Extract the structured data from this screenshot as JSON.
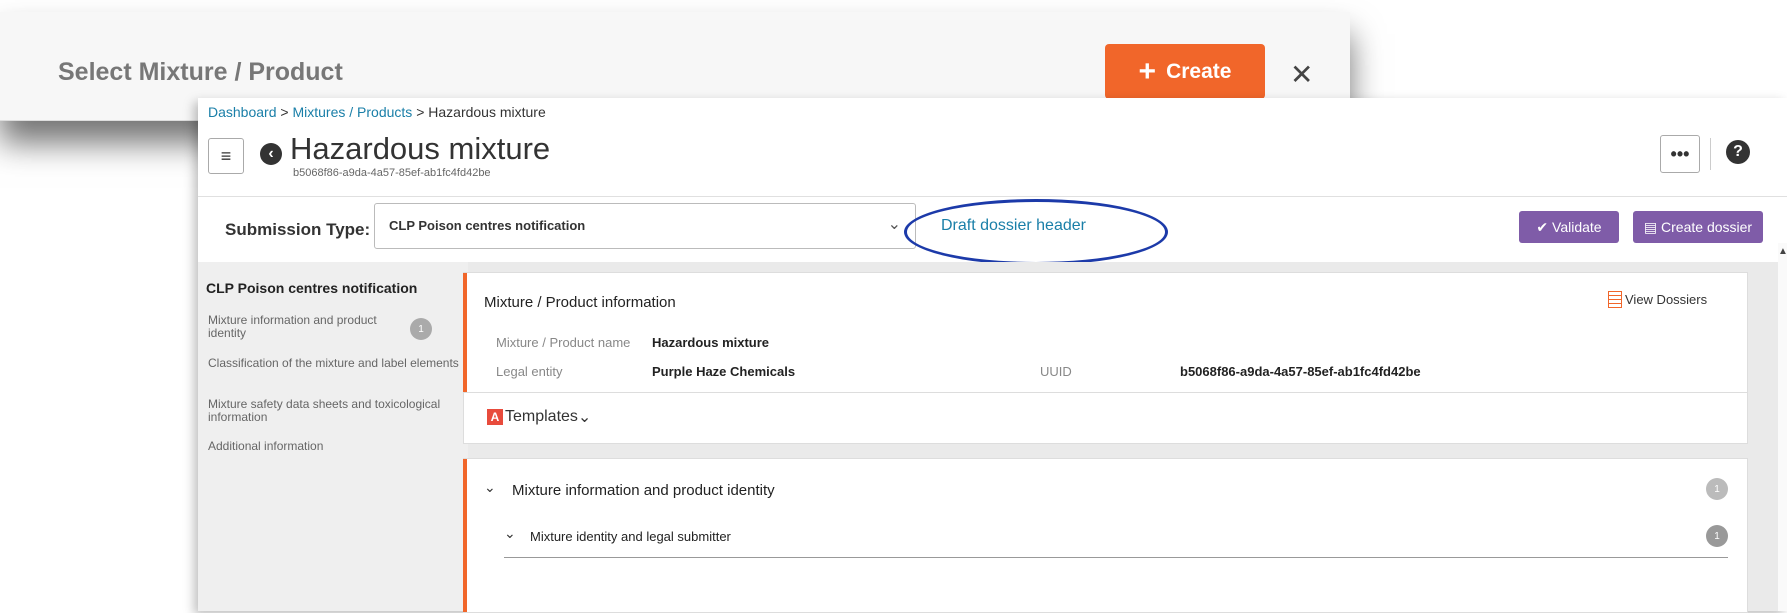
{
  "bg_dialog": {
    "title": "Select Mixture / Product",
    "create_label": "Create",
    "close_label": "✕"
  },
  "breadcrumb": {
    "items": [
      "Dashboard",
      "Mixtures / Products",
      "Hazardous mixture"
    ],
    "separator": ">"
  },
  "header": {
    "title": "Hazardous mixture",
    "uuid": "b5068f86-a9da-4a57-85ef-ab1fc4fd42be",
    "more_label": "•••",
    "help_label": "?"
  },
  "submission": {
    "label": "Submission Type:",
    "selected": "CLP Poison centres notification",
    "draft_link": "Draft dossier header",
    "validate_label": "Validate",
    "create_dossier_label": "Create dossier"
  },
  "sidebar": {
    "heading": "CLP Poison centres notification",
    "items": [
      {
        "label": "Mixture information and product identity",
        "badge": "1"
      },
      {
        "label": "Classification of the mixture and label elements"
      },
      {
        "label": "Mixture safety data sheets and toxicological information"
      },
      {
        "label": "Additional information"
      }
    ]
  },
  "mixture_panel": {
    "title": "Mixture / Product information",
    "view_dossiers": "View Dossiers",
    "name_label": "Mixture / Product name",
    "name_value": "Hazardous mixture",
    "legal_label": "Legal entity",
    "legal_value": "Purple Haze Chemicals",
    "uuid_label": "UUID",
    "uuid_value": "b5068f86-a9da-4a57-85ef-ab1fc4fd42be"
  },
  "templates": {
    "label": "Templates"
  },
  "section": {
    "title": "Mixture information and product identity",
    "badge": "1",
    "sub_title": "Mixture identity and legal submitter",
    "sub_badge": "1"
  },
  "colors": {
    "accent": "#f1662a",
    "link": "#1a7fa8",
    "button": "#7f5ca8",
    "oval": "#1c3aa9"
  }
}
